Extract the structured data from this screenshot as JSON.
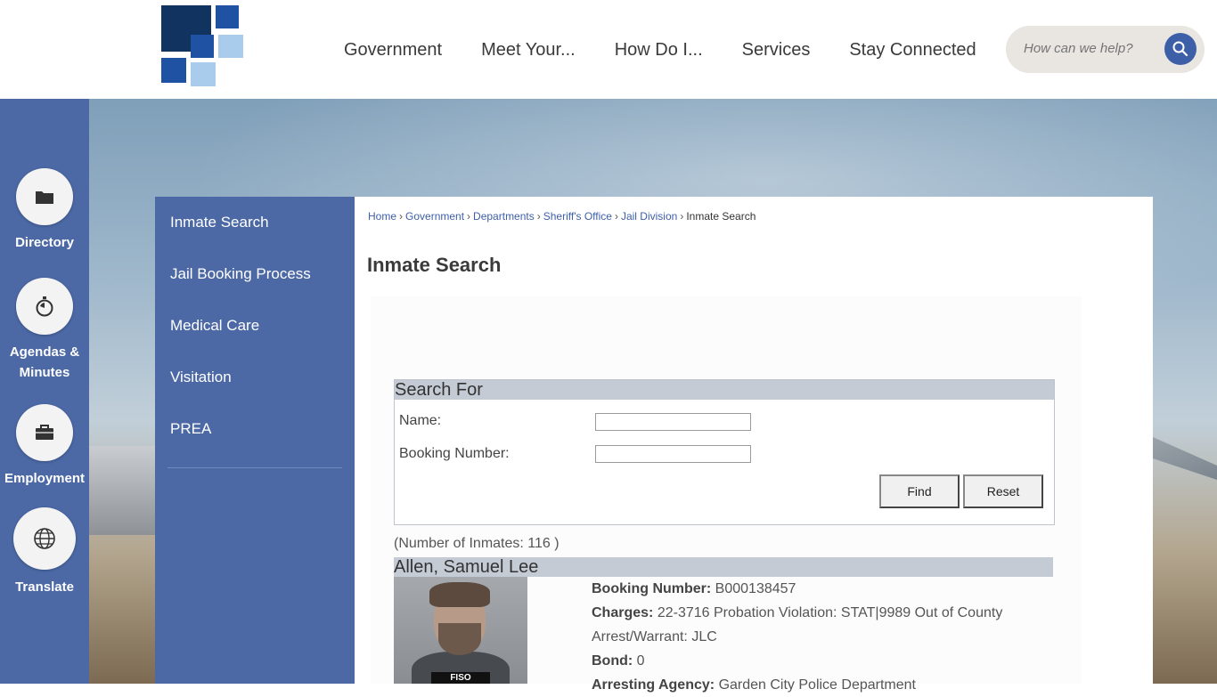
{
  "colors": {
    "brand_blue": "#4c69a6",
    "logo_dark": "#10335f",
    "logo_mid": "#1f52a3",
    "logo_light": "#a9cbec"
  },
  "header": {
    "nav": [
      "Government",
      "Meet Your...",
      "How Do I...",
      "Services",
      "Stay Connected"
    ],
    "search_placeholder": "How can we help?",
    "search_icon": "search-icon"
  },
  "quicklinks": [
    {
      "label": "Directory",
      "icon": "folder-icon"
    },
    {
      "label": "Agendas & Minutes",
      "icon": "stopwatch-icon"
    },
    {
      "label": "Employment",
      "icon": "briefcase-icon"
    },
    {
      "label": "Translate",
      "icon": "globe-icon"
    }
  ],
  "sidemenu": [
    "Inmate Search",
    "Jail Booking Process",
    "Medical Care",
    "Visitation",
    "PREA"
  ],
  "breadcrumb": {
    "links": [
      "Home",
      "Government",
      "Departments",
      "Sheriff's Office",
      "Jail Division"
    ],
    "current": "Inmate Search",
    "separator": "›"
  },
  "page_title": "Inmate Search",
  "search_form": {
    "header": "Search For",
    "name_label": "Name:",
    "name_value": "",
    "booking_label": "Booking Number:",
    "booking_value": "",
    "find_label": "Find",
    "reset_label": "Reset"
  },
  "results": {
    "count_text": "(Number of Inmates: 116 )",
    "inmate": {
      "name": "Allen, Samuel Lee",
      "photo_tag": "FISO",
      "booking_label": "Booking Number:",
      "booking_value": "B000138457",
      "charges_label": "Charges:",
      "charges_value": "22-3716 Probation Violation: STAT|9989 Out of County Arrest/Warrant: JLC",
      "bond_label": "Bond:",
      "bond_value": "0",
      "agency_label": "Arresting Agency:",
      "agency_value": "Garden City Police Department"
    }
  }
}
